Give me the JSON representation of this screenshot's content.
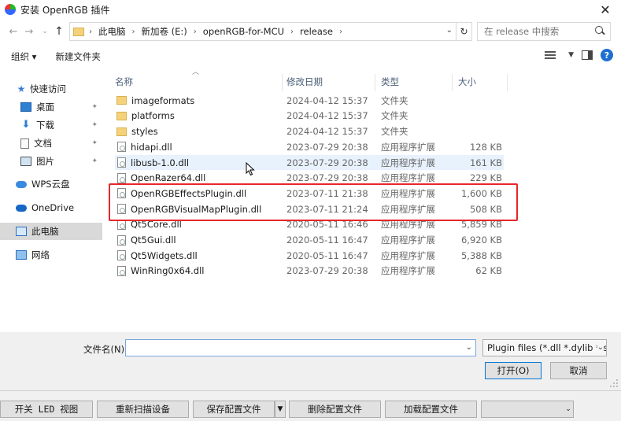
{
  "window": {
    "title": "安装 OpenRGB 插件",
    "close_glyph": "✕"
  },
  "address": {
    "crumbs": [
      "此电脑",
      "新加卷 (E:)",
      "openRGB-for-MCU",
      "release"
    ],
    "search_placeholder": "在 release 中搜索"
  },
  "toolbar": {
    "organize": "组织 ▾",
    "new_folder": "新建文件夹"
  },
  "nav": {
    "quick_access": "快速访问",
    "items": [
      {
        "label": "桌面",
        "pinned": true
      },
      {
        "label": "下载",
        "pinned": true
      },
      {
        "label": "文档",
        "pinned": true
      },
      {
        "label": "图片",
        "pinned": true
      }
    ],
    "wps": "WPS云盘",
    "onedrive": "OneDrive",
    "this_pc": "此电脑",
    "network": "网络"
  },
  "columns": {
    "name": "名称",
    "date": "修改日期",
    "type": "类型",
    "size": "大小"
  },
  "files": [
    {
      "name": "imageformats",
      "date": "2024-04-12 15:37",
      "type": "文件夹",
      "size": "",
      "kind": "folder"
    },
    {
      "name": "platforms",
      "date": "2024-04-12 15:37",
      "type": "文件夹",
      "size": "",
      "kind": "folder"
    },
    {
      "name": "styles",
      "date": "2024-04-12 15:37",
      "type": "文件夹",
      "size": "",
      "kind": "folder"
    },
    {
      "name": "hidapi.dll",
      "date": "2023-07-29 20:38",
      "type": "应用程序扩展",
      "size": "128 KB",
      "kind": "dll"
    },
    {
      "name": "libusb-1.0.dll",
      "date": "2023-07-29 20:38",
      "type": "应用程序扩展",
      "size": "161 KB",
      "kind": "dll"
    },
    {
      "name": "OpenRazer64.dll",
      "date": "2023-07-29 20:38",
      "type": "应用程序扩展",
      "size": "229 KB",
      "kind": "dll"
    },
    {
      "name": "OpenRGBEffectsPlugin.dll",
      "date": "2023-07-11 21:38",
      "type": "应用程序扩展",
      "size": "1,600 KB",
      "kind": "dll"
    },
    {
      "name": "OpenRGBVisualMapPlugin.dll",
      "date": "2023-07-11 21:24",
      "type": "应用程序扩展",
      "size": "508 KB",
      "kind": "dll"
    },
    {
      "name": "Qt5Core.dll",
      "date": "2020-05-11 16:46",
      "type": "应用程序扩展",
      "size": "5,859 KB",
      "kind": "dll"
    },
    {
      "name": "Qt5Gui.dll",
      "date": "2020-05-11 16:47",
      "type": "应用程序扩展",
      "size": "6,920 KB",
      "kind": "dll"
    },
    {
      "name": "Qt5Widgets.dll",
      "date": "2020-05-11 16:47",
      "type": "应用程序扩展",
      "size": "5,388 KB",
      "kind": "dll"
    },
    {
      "name": "WinRing0x64.dll",
      "date": "2023-07-29 20:38",
      "type": "应用程序扩展",
      "size": "62 KB",
      "kind": "dll"
    }
  ],
  "bottom": {
    "filename_label": "文件名(N):",
    "filename_value": "",
    "filter": "Plugin files (*.dll *.dylib *.so *",
    "open": "打开(O)",
    "cancel": "取消"
  },
  "app_buttons": {
    "led_view": "开关 LED 视图",
    "rescan": "重新扫描设备",
    "save_profile": "保存配置文件",
    "delete_profile": "删除配置文件",
    "load_profile": "加载配置文件",
    "profile_select": ""
  },
  "colors": {
    "highlight": "#e8262a",
    "accent": "#0078d7"
  }
}
